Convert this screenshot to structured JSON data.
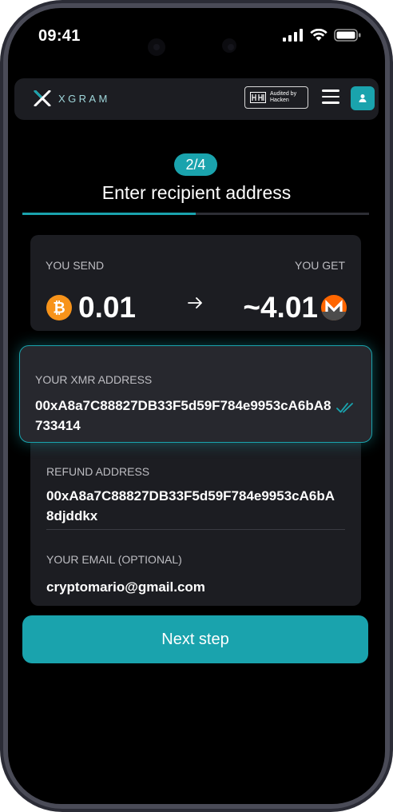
{
  "status_bar": {
    "time": "09:41"
  },
  "header": {
    "logo_text": "XGRAM",
    "audit_badge": {
      "line1": "Audited by",
      "line2": "Hacken"
    }
  },
  "step": {
    "indicator": "2/4",
    "current": 2,
    "total": 4,
    "progress": 0.5,
    "title": "Enter recipient address"
  },
  "exchange": {
    "send_label": "YOU SEND",
    "get_label": "YOU GET",
    "send_amount": "0.01",
    "send_currency_icon": "bitcoin-icon",
    "get_amount": "~4.01",
    "get_currency_icon": "monero-icon"
  },
  "fields": {
    "xmr_address": {
      "label": "YOUR XMR ADDRESS",
      "value": "00xA8a7C88827DB33F5d59F784e9953cA6bA8733414",
      "status_icon": "double-check-icon"
    },
    "refund_address": {
      "label": "REFUND ADDRESS",
      "value": "00xA8a7C88827DB33F5d59F784e9953cA6bA8djddkx"
    },
    "email": {
      "label": "YOUR EMAIL (OPTIONAL)",
      "value": "cryptomario@gmail.com"
    }
  },
  "next_button": {
    "label": "Next step"
  },
  "colors": {
    "accent": "#1aa3ad",
    "background": "#000000",
    "card": "#1c1d22",
    "bitcoin": "#f7931a",
    "monero": "#ff6600"
  }
}
